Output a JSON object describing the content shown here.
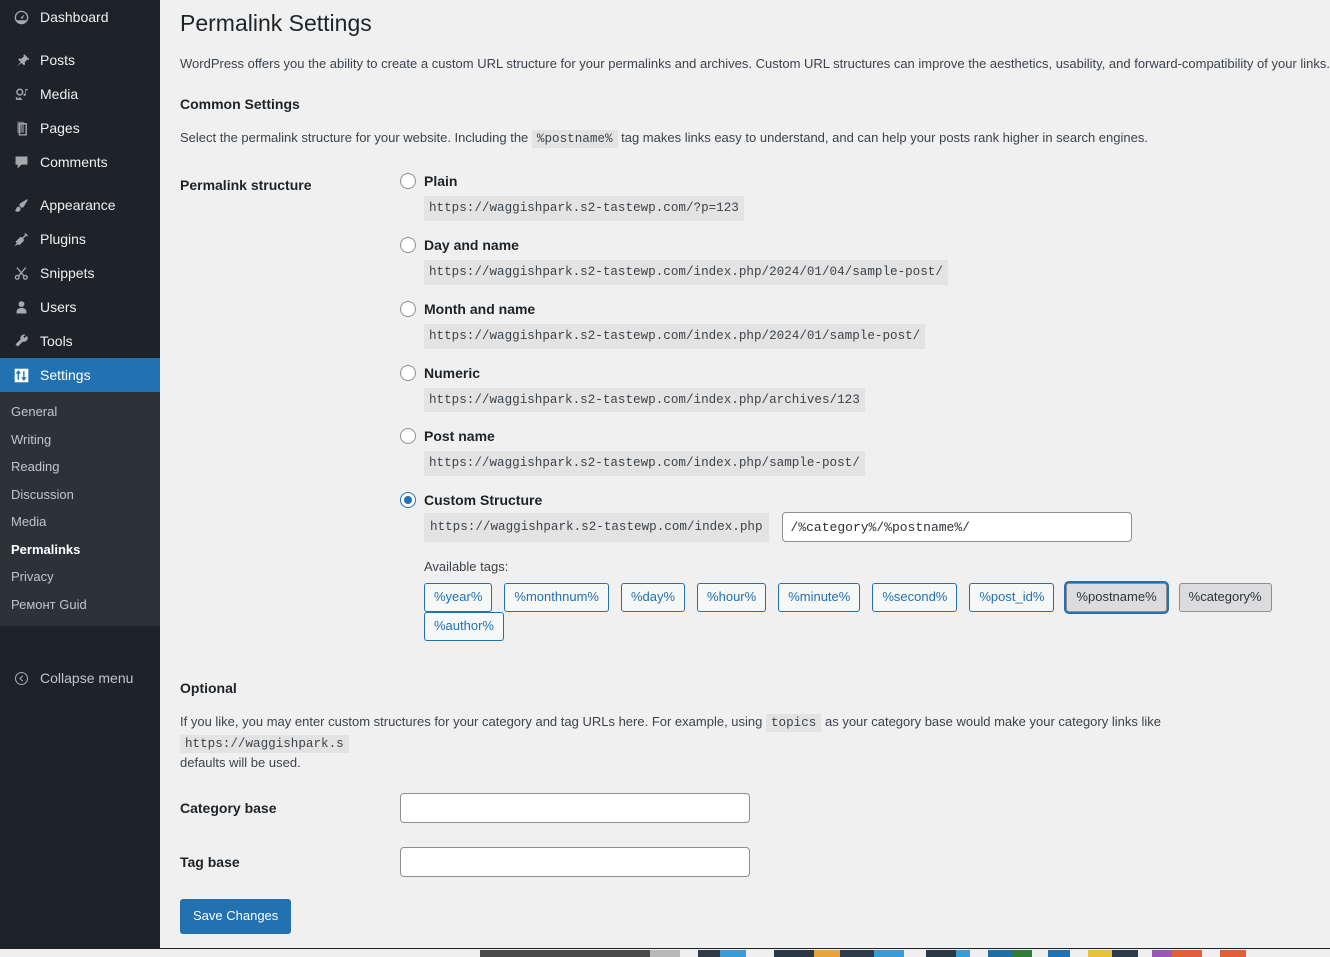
{
  "sidebar": {
    "items": [
      {
        "label": "Dashboard",
        "icon": "dashboard-icon"
      },
      {
        "label": "Posts",
        "icon": "pushpin-icon"
      },
      {
        "label": "Media",
        "icon": "media-icon"
      },
      {
        "label": "Pages",
        "icon": "pages-icon"
      },
      {
        "label": "Comments",
        "icon": "comment-icon"
      },
      {
        "label": "Appearance",
        "icon": "paintbrush-icon"
      },
      {
        "label": "Plugins",
        "icon": "plug-icon"
      },
      {
        "label": "Snippets",
        "icon": "scissors-icon"
      },
      {
        "label": "Users",
        "icon": "user-icon"
      },
      {
        "label": "Tools",
        "icon": "wrench-icon"
      },
      {
        "label": "Settings",
        "icon": "settings-icon"
      }
    ],
    "submenu": [
      {
        "label": "General"
      },
      {
        "label": "Writing"
      },
      {
        "label": "Reading"
      },
      {
        "label": "Discussion"
      },
      {
        "label": "Media"
      },
      {
        "label": "Permalinks"
      },
      {
        "label": "Privacy"
      },
      {
        "label": "Ремонт Guid"
      }
    ],
    "collapse_label": "Collapse menu",
    "active_item": "Settings",
    "active_subitem": "Permalinks",
    "accent_color": "#2271b1",
    "background_color": "#1d2327",
    "submenu_background": "#2c3338"
  },
  "page": {
    "title": "Permalink Settings",
    "intro": "WordPress offers you the ability to create a custom URL structure for your permalinks and archives. Custom URL structures can improve the aesthetics, usability, and forward-compatibility of your links.",
    "common_settings_heading": "Common Settings",
    "common_settings_desc_part1": "Select the permalink structure for your website. Including the",
    "common_settings_code": "%postname%",
    "common_settings_desc_part2": "tag makes links easy to understand, and can help your posts rank higher in search engines.",
    "permalink_structure_label": "Permalink structure"
  },
  "options": [
    {
      "label": "Plain",
      "example": "https://waggishpark.s2-tastewp.com/?p=123",
      "selected": false
    },
    {
      "label": "Day and name",
      "example": "https://waggishpark.s2-tastewp.com/index.php/2024/01/04/sample-post/",
      "selected": false
    },
    {
      "label": "Month and name",
      "example": "https://waggishpark.s2-tastewp.com/index.php/2024/01/sample-post/",
      "selected": false
    },
    {
      "label": "Numeric",
      "example": "https://waggishpark.s2-tastewp.com/index.php/archives/123",
      "selected": false
    },
    {
      "label": "Post name",
      "example": "https://waggishpark.s2-tastewp.com/index.php/sample-post/",
      "selected": false
    }
  ],
  "custom": {
    "label": "Custom Structure",
    "selected": true,
    "prefix": "https://waggishpark.s2-tastewp.com/index.php",
    "value": "/%category%/%postname%/",
    "available_tags_label": "Available tags:",
    "tags": [
      {
        "label": "%year%",
        "state": "normal"
      },
      {
        "label": "%monthnum%",
        "state": "normal"
      },
      {
        "label": "%day%",
        "state": "normal"
      },
      {
        "label": "%hour%",
        "state": "normal"
      },
      {
        "label": "%minute%",
        "state": "normal"
      },
      {
        "label": "%second%",
        "state": "normal"
      },
      {
        "label": "%post_id%",
        "state": "normal"
      },
      {
        "label": "%postname%",
        "state": "focused"
      },
      {
        "label": "%category%",
        "state": "used"
      },
      {
        "label": "%author%",
        "state": "normal"
      }
    ]
  },
  "optional": {
    "heading": "Optional",
    "desc_part1": "If you like, you may enter custom structures for your category and tag URLs here. For example, using",
    "desc_code1": "topics",
    "desc_part2": "as your category base would make your category links like",
    "desc_code2": "https://waggishpark.s",
    "desc_part3": "defaults will be used.",
    "category_base_label": "Category base",
    "category_base_value": "",
    "tag_base_label": "Tag base",
    "tag_base_value": ""
  },
  "save_button_label": "Save Changes"
}
